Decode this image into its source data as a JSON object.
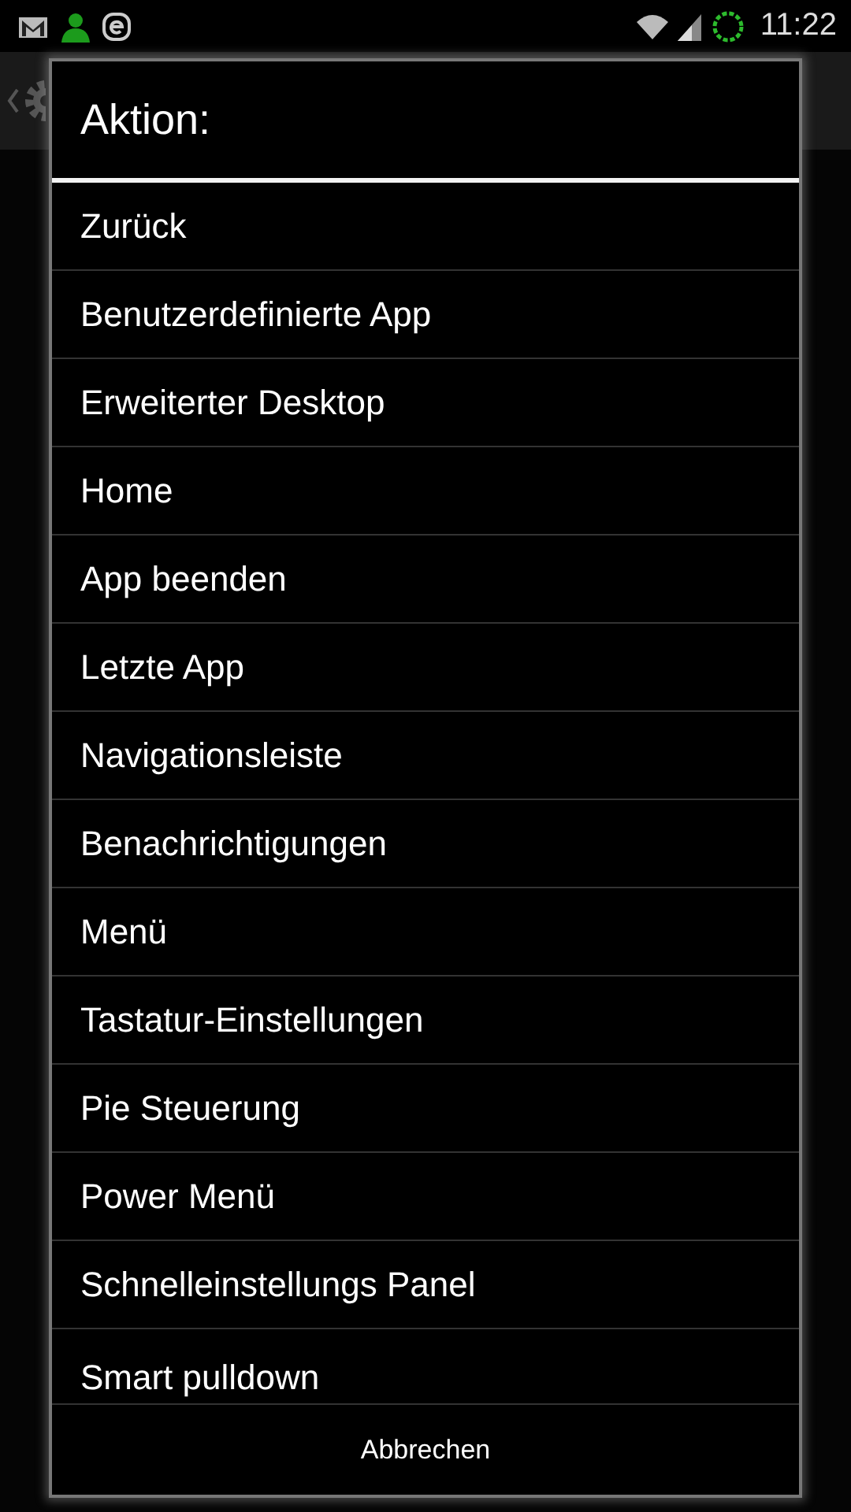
{
  "status_bar": {
    "time": "11:22"
  },
  "dialog": {
    "title": "Aktion:",
    "items": [
      {
        "label": "Zurück"
      },
      {
        "label": "Benutzerdefinierte App"
      },
      {
        "label": "Erweiterter Desktop"
      },
      {
        "label": "Home"
      },
      {
        "label": "App beenden"
      },
      {
        "label": "Letzte App"
      },
      {
        "label": "Navigationsleiste"
      },
      {
        "label": "Benachrichtigungen"
      },
      {
        "label": "Menü"
      },
      {
        "label": "Tastatur-Einstellungen"
      },
      {
        "label": "Pie Steuerung"
      },
      {
        "label": "Power Menü"
      },
      {
        "label": "Schnelleinstellungs Panel"
      },
      {
        "label": "Smart pulldown"
      }
    ],
    "cancel_button": "Abbrechen"
  }
}
